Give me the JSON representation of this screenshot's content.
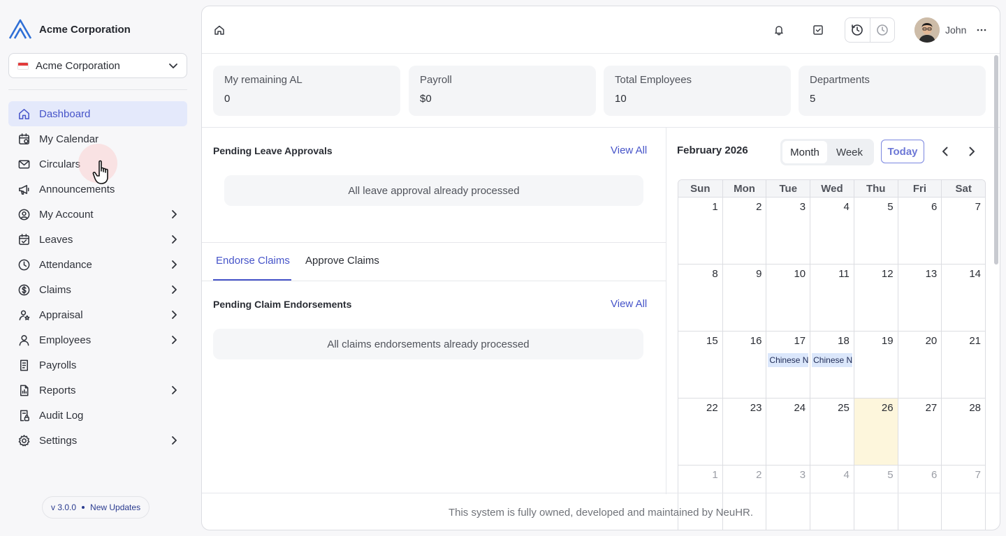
{
  "brand": {
    "name": "Acme Corporation"
  },
  "company_select": {
    "value": "Acme Corporation"
  },
  "sidebar": {
    "items": [
      {
        "label": "Dashboard",
        "icon": "home-icon"
      },
      {
        "label": "My Calendar",
        "icon": "calendar-icon"
      },
      {
        "label": "Circulars",
        "icon": "mail-icon"
      },
      {
        "label": "Announcements",
        "icon": "megaphone-icon"
      },
      {
        "label": "My Account",
        "icon": "user-circle-icon"
      },
      {
        "label": "Leaves",
        "icon": "calendar-check-icon"
      },
      {
        "label": "Attendance",
        "icon": "clock-icon"
      },
      {
        "label": "Claims",
        "icon": "dollar-icon"
      },
      {
        "label": "Appraisal",
        "icon": "user-star-icon"
      },
      {
        "label": "Employees",
        "icon": "user-icon"
      },
      {
        "label": "Payrolls",
        "icon": "receipt-icon"
      },
      {
        "label": "Reports",
        "icon": "report-icon"
      },
      {
        "label": "Audit Log",
        "icon": "file-lock-icon"
      },
      {
        "label": "Settings",
        "icon": "gear-icon"
      }
    ]
  },
  "version": {
    "number": "v 3.0.0",
    "updates": "New Updates"
  },
  "topbar": {
    "user_name": "John"
  },
  "stats": [
    {
      "label": "My remaining AL",
      "value": "0"
    },
    {
      "label": "Payroll",
      "value": "$0"
    },
    {
      "label": "Total Employees",
      "value": "10"
    },
    {
      "label": "Departments",
      "value": "5"
    }
  ],
  "leave": {
    "title": "Pending Leave Approvals",
    "view_all": "View All",
    "empty": "All leave approval already processed"
  },
  "claims": {
    "tabs": [
      "Endorse Claims",
      "Approve Claims"
    ],
    "title": "Pending Claim Endorsements",
    "view_all": "View All",
    "empty": "All claims endorsements already processed"
  },
  "calendar": {
    "title": "February 2026",
    "views": [
      "Month",
      "Week"
    ],
    "today_label": "Today",
    "weekdays": [
      "Sun",
      "Mon",
      "Tue",
      "Wed",
      "Thu",
      "Fri",
      "Sat"
    ],
    "weeks": [
      [
        "1",
        "2",
        "3",
        "4",
        "5",
        "6",
        "7"
      ],
      [
        "8",
        "9",
        "10",
        "11",
        "12",
        "13",
        "14"
      ],
      [
        "15",
        "16",
        "17",
        "18",
        "19",
        "20",
        "21"
      ],
      [
        "22",
        "23",
        "24",
        "25",
        "26",
        "27",
        "28"
      ],
      [
        "1",
        "2",
        "3",
        "4",
        "5",
        "6",
        "7"
      ]
    ],
    "events": [
      {
        "day": "17",
        "label": "Chinese N"
      },
      {
        "day": "18",
        "label": "Chinese N"
      }
    ]
  },
  "footer": {
    "text": "This system is fully owned, developed and maintained by NeuHR."
  },
  "colors": {
    "accent": "#4654c9",
    "today_bg": "#fdf6dc",
    "event_bg": "#dbe7fb"
  }
}
